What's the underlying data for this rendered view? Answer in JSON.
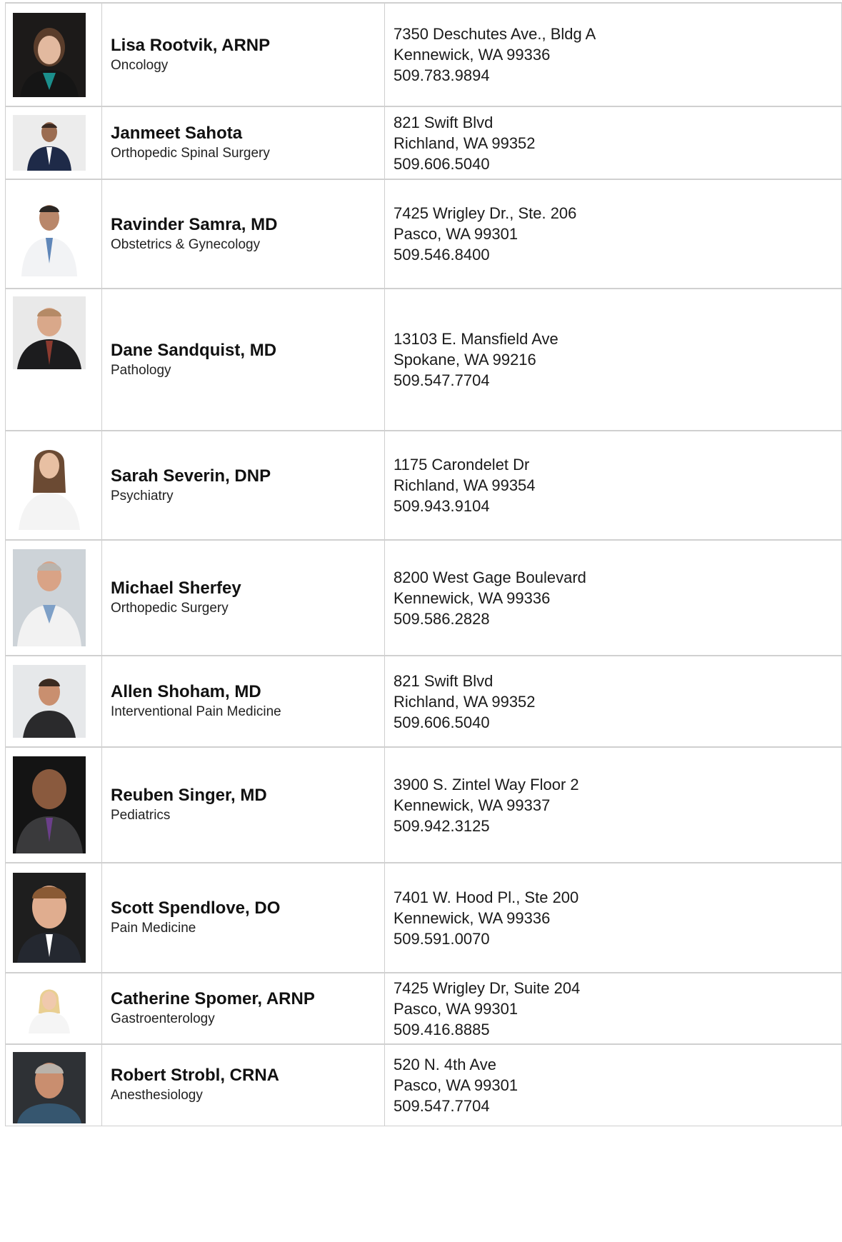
{
  "providers": [
    {
      "name": "Lisa Rootvik, ARNP",
      "specialty": "Oncology",
      "address1": "7350 Deschutes Ave., Bldg A",
      "address2": "Kennewick, WA 99336",
      "phone": "509.783.9894",
      "photo_desc": "woman-portrait-dark-bg"
    },
    {
      "name": "Janmeet Sahota",
      "specialty": "Orthopedic Spinal Surgery",
      "address1": "821 Swift Blvd",
      "address2": "Richland, WA 99352",
      "phone": "509.606.5040",
      "photo_desc": "man-suit-portrait"
    },
    {
      "name": "Ravinder Samra, MD",
      "specialty": "Obstetrics & Gynecology",
      "address1": "7425 Wrigley Dr., Ste. 206",
      "address2": "Pasco, WA 99301",
      "phone": "509.546.8400",
      "photo_desc": "man-white-coat-portrait"
    },
    {
      "name": "Dane Sandquist, MD",
      "specialty": "Pathology",
      "address1": "13103 E. Mansfield Ave",
      "address2": "Spokane, WA 99216",
      "phone": "509.547.7704",
      "photo_desc": "man-suit-portrait"
    },
    {
      "name": "Sarah Severin, DNP",
      "specialty": "Psychiatry",
      "address1": "1175 Carondelet Dr",
      "address2": "Richland, WA 99354",
      "phone": "509.943.9104",
      "photo_desc": "woman-white-coat-portrait"
    },
    {
      "name": "Michael Sherfey",
      "specialty": "Orthopedic Surgery",
      "address1": "8200 West Gage Boulevard",
      "address2": "Kennewick, WA 99336",
      "phone": "509.586.2828",
      "photo_desc": "man-white-coat-portrait"
    },
    {
      "name": "Allen Shoham, MD",
      "specialty": "Interventional Pain Medicine",
      "address1": "821 Swift Blvd",
      "address2": "Richland, WA 99352",
      "phone": "509.606.5040",
      "photo_desc": "man-scrubs-portrait"
    },
    {
      "name": "Reuben Singer, MD",
      "specialty": "Pediatrics",
      "address1": "3900 S. Zintel Way Floor 2",
      "address2": "Kennewick, WA 99337",
      "phone": "509.942.3125",
      "photo_desc": "man-suit-dark-bg"
    },
    {
      "name": "Scott Spendlove, DO",
      "specialty": "Pain Medicine",
      "address1": "7401 W. Hood Pl., Ste 200",
      "address2": "Kennewick, WA 99336",
      "phone": "509.591.0070",
      "photo_desc": "man-suit-dark-bg"
    },
    {
      "name": "Catherine Spomer, ARNP",
      "specialty": "Gastroenterology",
      "address1": "7425 Wrigley Dr, Suite 204",
      "address2": "Pasco, WA 99301",
      "phone": "509.416.8885",
      "photo_desc": "woman-white-coat-portrait"
    },
    {
      "name": "Robert Strobl, CRNA",
      "specialty": "Anesthesiology",
      "address1": "520 N. 4th Ave",
      "address2": "Pasco, WA 99301",
      "phone": "509.547.7704",
      "photo_desc": "man-scrubs-dark-bg"
    }
  ],
  "colors": {
    "border": "#cfcfcf",
    "text": "#111111"
  }
}
